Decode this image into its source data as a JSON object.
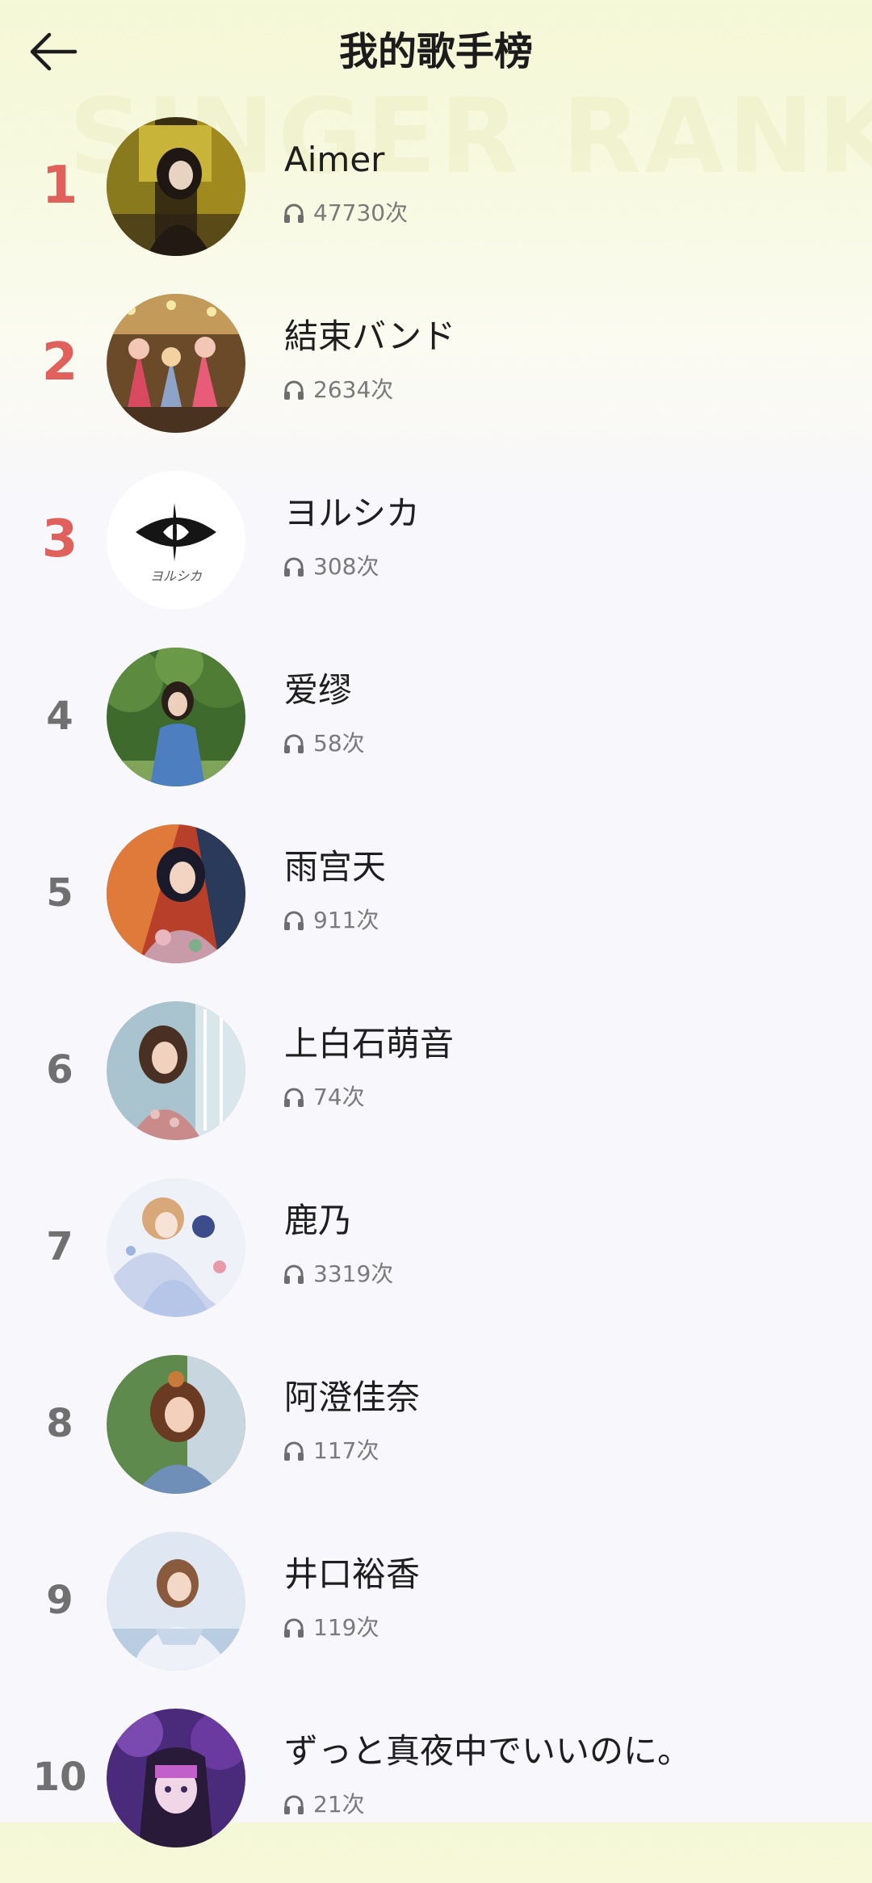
{
  "header": {
    "title": "我的歌手榜",
    "watermark": "SINGER RANK",
    "back_icon": "arrow-left-icon"
  },
  "colors": {
    "rank_top": "#e0605c",
    "rank_other": "#707070",
    "count_text": "#7a7a7a"
  },
  "play_icon": "headphones-icon",
  "singers": [
    {
      "rank": "1",
      "name": "Aimer",
      "plays": "47730次"
    },
    {
      "rank": "2",
      "name": "結束バンド",
      "plays": "2634次"
    },
    {
      "rank": "3",
      "name": "ヨルシカ",
      "plays": "308次",
      "logo_text": "ヨルシカ"
    },
    {
      "rank": "4",
      "name": "爱缪",
      "plays": "58次"
    },
    {
      "rank": "5",
      "name": "雨宫天",
      "plays": "911次"
    },
    {
      "rank": "6",
      "name": "上白石萌音",
      "plays": "74次"
    },
    {
      "rank": "7",
      "name": "鹿乃",
      "plays": "3319次"
    },
    {
      "rank": "8",
      "name": "阿澄佳奈",
      "plays": "117次"
    },
    {
      "rank": "9",
      "name": "井口裕香",
      "plays": "119次"
    },
    {
      "rank": "10",
      "name": "ずっと真夜中でいいのに。",
      "plays": "21次"
    }
  ]
}
